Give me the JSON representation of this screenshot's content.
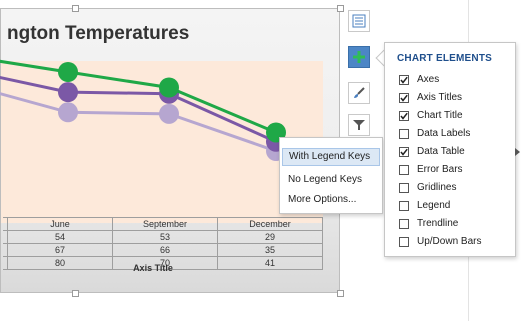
{
  "chart": {
    "title": "ngton Temperatures",
    "axis_title": "Axis Title"
  },
  "chart_data": {
    "type": "line",
    "categories": [
      "June",
      "September",
      "December"
    ],
    "series": [
      {
        "values": [
          80,
          70,
          41
        ],
        "color": "#1fa847"
      },
      {
        "values": [
          67,
          66,
          35
        ],
        "color": "#7b58a6"
      },
      {
        "values": [
          54,
          53,
          29
        ],
        "color": "#b6a6d0"
      }
    ],
    "table_rows": [
      [
        "54",
        "53",
        "29"
      ],
      [
        "67",
        "66",
        "35"
      ],
      [
        "80",
        "70",
        "41"
      ]
    ]
  },
  "submenu": {
    "items": [
      "With Legend Keys",
      "No Legend Keys",
      "More Options..."
    ]
  },
  "panel": {
    "title": "CHART ELEMENTS",
    "items": [
      {
        "label": "Axes",
        "checked": true
      },
      {
        "label": "Axis Titles",
        "checked": true
      },
      {
        "label": "Chart Title",
        "checked": true
      },
      {
        "label": "Data Labels",
        "checked": false
      },
      {
        "label": "Data Table",
        "checked": true,
        "has_submenu": true
      },
      {
        "label": "Error Bars",
        "checked": false
      },
      {
        "label": "Gridlines",
        "checked": false
      },
      {
        "label": "Legend",
        "checked": false
      },
      {
        "label": "Trendline",
        "checked": false
      },
      {
        "label": "Up/Down Bars",
        "checked": false
      }
    ]
  },
  "side_buttons": [
    "layout-icon",
    "plus-icon",
    "brush-icon",
    "filter-icon"
  ]
}
